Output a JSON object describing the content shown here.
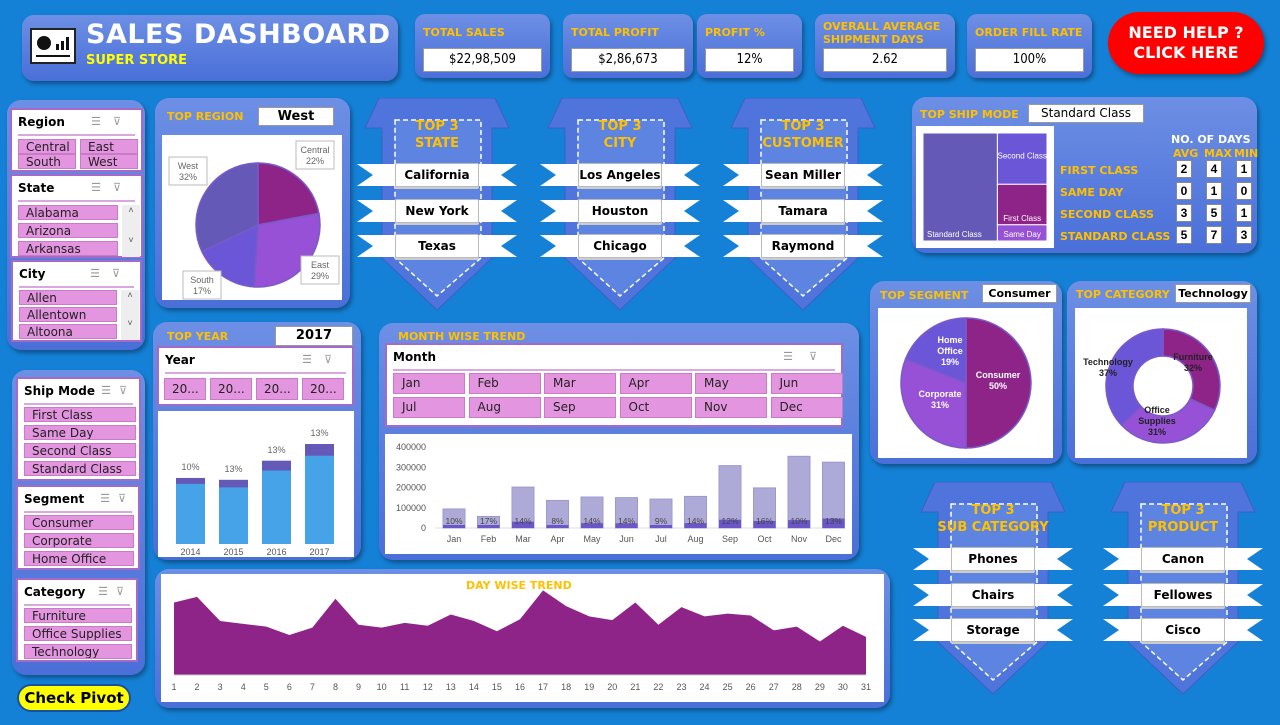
{
  "header": {
    "title": "SALES DASHBOARD",
    "subtitle": "SUPER STORE",
    "logo_icon": "dashboard-icon"
  },
  "kpis": [
    {
      "label": "TOTAL SALES",
      "value": "$22,98,509"
    },
    {
      "label": "TOTAL PROFIT",
      "value": "$2,86,673"
    },
    {
      "label": "PROFIT %",
      "value": "12%"
    },
    {
      "label": "OVERALL AVERAGE SHIPMENT DAYS",
      "value": "2.62"
    },
    {
      "label": "ORDER FILL RATE",
      "value": "100%"
    }
  ],
  "help_button": {
    "line1": "NEED HELP ?",
    "line2": "CLICK HERE"
  },
  "slicers": {
    "region": {
      "title": "Region",
      "items": [
        "Central",
        "East",
        "South",
        "West"
      ]
    },
    "state": {
      "title": "State",
      "items": [
        "Alabama",
        "Arizona",
        "Arkansas"
      ]
    },
    "city": {
      "title": "City",
      "items": [
        "Allen",
        "Allentown",
        "Altoona"
      ]
    },
    "ship_mode": {
      "title": "Ship Mode",
      "items": [
        "First Class",
        "Same Day",
        "Second Class",
        "Standard Class"
      ]
    },
    "segment": {
      "title": "Segment",
      "items": [
        "Consumer",
        "Corporate",
        "Home Office"
      ]
    },
    "category": {
      "title": "Category",
      "items": [
        "Furniture",
        "Office Supplies",
        "Technology"
      ]
    },
    "year": {
      "title": "Year",
      "items": [
        "20...",
        "20...",
        "20...",
        "20..."
      ]
    },
    "month": {
      "title": "Month",
      "items": [
        "Jan",
        "Feb",
        "Mar",
        "Apr",
        "May",
        "Jun",
        "Jul",
        "Aug",
        "Sep",
        "Oct",
        "Nov",
        "Dec"
      ]
    }
  },
  "check_pivot": "Check Pivot",
  "top_region": {
    "label": "TOP REGION",
    "value": "West"
  },
  "top_year": {
    "label": "TOP YEAR",
    "value": "2017"
  },
  "top_ship_mode": {
    "label": "TOP SHIP MODE",
    "value": "Standard Class",
    "days_header": "NO. OF DAYS",
    "cols": [
      "AVG",
      "MAX",
      "MIN"
    ],
    "rows": [
      {
        "mode": "FIRST CLASS",
        "avg": "2",
        "max": "4",
        "min": "1"
      },
      {
        "mode": "SAME DAY",
        "avg": "0",
        "max": "1",
        "min": "0"
      },
      {
        "mode": "SECOND CLASS",
        "avg": "3",
        "max": "5",
        "min": "1"
      },
      {
        "mode": "STANDARD CLASS",
        "avg": "5",
        "max": "7",
        "min": "3"
      }
    ]
  },
  "top_segment": {
    "label": "TOP SEGMENT",
    "value": "Consumer"
  },
  "top_category": {
    "label": "TOP CATEGORY",
    "value": "Technology"
  },
  "month_wise_title": "MONTH WISE TREND",
  "day_wise_title": "DAY WISE TREND",
  "top3": [
    {
      "title1": "TOP 3",
      "title2": "STATE",
      "items": [
        "California",
        "New York",
        "Texas"
      ]
    },
    {
      "title1": "TOP 3",
      "title2": "CITY",
      "items": [
        "Los Angeles",
        "Houston",
        "Chicago"
      ]
    },
    {
      "title1": "TOP 3",
      "title2": "CUSTOMER",
      "items": [
        "Sean Miller",
        "Tamara",
        "Raymond"
      ]
    },
    {
      "title1": "TOP 3",
      "title2": "SUB CATEGORY",
      "items": [
        "Phones",
        "Chairs",
        "Storage"
      ]
    },
    {
      "title1": "TOP 3",
      "title2": "PRODUCT",
      "items": [
        "Canon",
        "Fellowes",
        "Cisco"
      ]
    }
  ],
  "colors": {
    "purple_dark": "#8e2487",
    "purple_mid": "#9651d6",
    "violet": "#6c56d8",
    "slate": "#6559b8",
    "light_blue": "#46a3e8",
    "gold": "#ffc000",
    "help_red": "#ff0000"
  },
  "chart_data": [
    {
      "type": "pie",
      "title": "Top Region",
      "labels": [
        "Central",
        "East",
        "South",
        "West"
      ],
      "values": [
        22,
        29,
        17,
        32
      ],
      "unit": "%"
    },
    {
      "type": "treemap",
      "title": "Top Ship Mode",
      "labels": [
        "Standard Class",
        "Second Class",
        "First Class",
        "Same Day"
      ],
      "values": [
        60,
        19,
        15,
        6
      ]
    },
    {
      "type": "pie",
      "title": "Top Segment",
      "labels": [
        "Consumer",
        "Corporate",
        "Home Office"
      ],
      "values": [
        50,
        31,
        19
      ],
      "unit": "%"
    },
    {
      "type": "pie",
      "subtype": "donut",
      "title": "Top Category",
      "labels": [
        "Furniture",
        "Office Supplies",
        "Technology"
      ],
      "values": [
        32,
        31,
        37
      ],
      "unit": "%"
    },
    {
      "type": "bar",
      "title": "Year-wise Sales & Profit",
      "categories": [
        "2014",
        "2015",
        "2016",
        "2017"
      ],
      "series": [
        {
          "name": "Sales",
          "values": [
            484000,
            470000,
            610000,
            733000
          ]
        }
      ],
      "profit_pct": [
        10,
        13,
        13,
        13
      ],
      "data_labels": [
        "10%",
        "13%",
        "13%",
        "13%"
      ]
    },
    {
      "type": "bar",
      "title": "Month Wise Trend",
      "categories": [
        "Jan",
        "Feb",
        "Mar",
        "Apr",
        "May",
        "Jun",
        "Jul",
        "Aug",
        "Sep",
        "Oct",
        "Nov",
        "Dec"
      ],
      "series": [
        {
          "name": "Sales",
          "values": [
            94000,
            57000,
            202000,
            136000,
            153000,
            150000,
            143000,
            156000,
            308000,
            198000,
            354000,
            325000
          ]
        }
      ],
      "profit_pct": [
        10,
        17,
        14,
        8,
        14,
        14,
        9,
        14,
        12,
        16,
        10,
        13
      ],
      "data_labels": [
        "10%",
        "17%",
        "14%",
        "8%",
        "14%",
        "14%",
        "9%",
        "14%",
        "12%",
        "16%",
        "10%",
        "13%"
      ],
      "yticks": [
        0,
        100000,
        200000,
        300000,
        400000
      ],
      "ylim": [
        0,
        400000
      ]
    },
    {
      "type": "area",
      "title": "DAY WISE TREND",
      "x": [
        1,
        2,
        3,
        4,
        5,
        6,
        7,
        8,
        9,
        10,
        11,
        12,
        13,
        14,
        15,
        16,
        17,
        18,
        19,
        20,
        21,
        22,
        23,
        24,
        25,
        26,
        27,
        28,
        29,
        30,
        31
      ],
      "values": [
        78,
        84,
        58,
        55,
        52,
        43,
        51,
        82,
        54,
        51,
        56,
        53,
        65,
        58,
        47,
        60,
        91,
        74,
        63,
        59,
        78,
        54,
        73,
        63,
        66,
        64,
        48,
        52,
        36,
        53,
        41
      ],
      "ylim": [
        0,
        100
      ],
      "value_scale": "relative (no axis shown)"
    }
  ]
}
